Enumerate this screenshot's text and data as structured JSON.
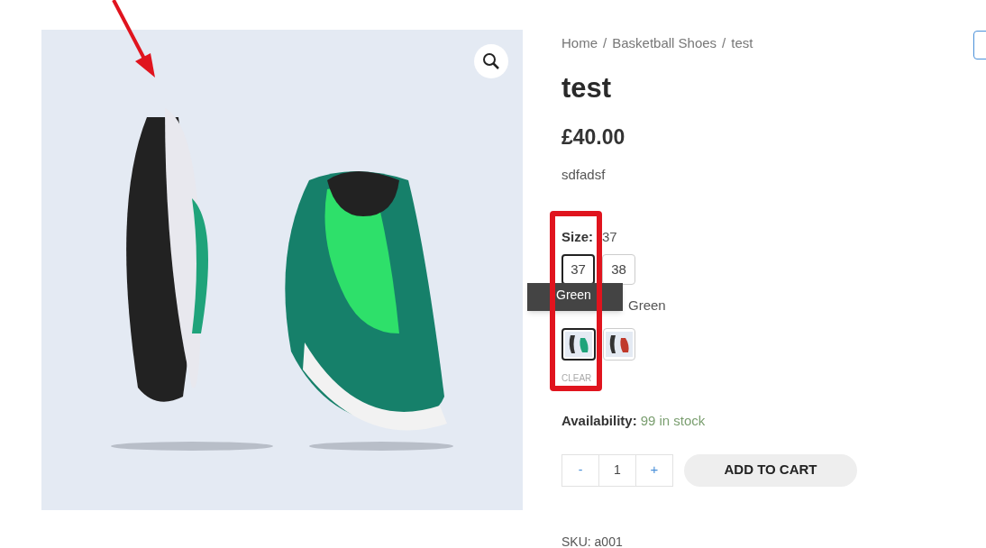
{
  "breadcrumb": {
    "items": [
      "Home",
      "Basketball Shoes",
      "test"
    ],
    "separator": "/"
  },
  "product": {
    "title": "test",
    "price": "£40.00",
    "description": "sdfadsf"
  },
  "attributes": [
    {
      "kind": "text",
      "label": "Size:",
      "value": "37",
      "options": [
        {
          "label": "37",
          "selected": true
        },
        {
          "label": "38",
          "selected": false
        }
      ]
    },
    {
      "kind": "image",
      "value": "Green",
      "tooltip": "Green",
      "options": [
        {
          "selected": true
        },
        {
          "selected": false
        }
      ]
    }
  ],
  "clear": "CLEAR",
  "availability": {
    "label": "Availability:",
    "value": "99 in stock"
  },
  "quantity": {
    "minus": "-",
    "value": "1",
    "plus": "+"
  },
  "add_to_cart": "ADD TO CART",
  "sku": "SKU: a001"
}
